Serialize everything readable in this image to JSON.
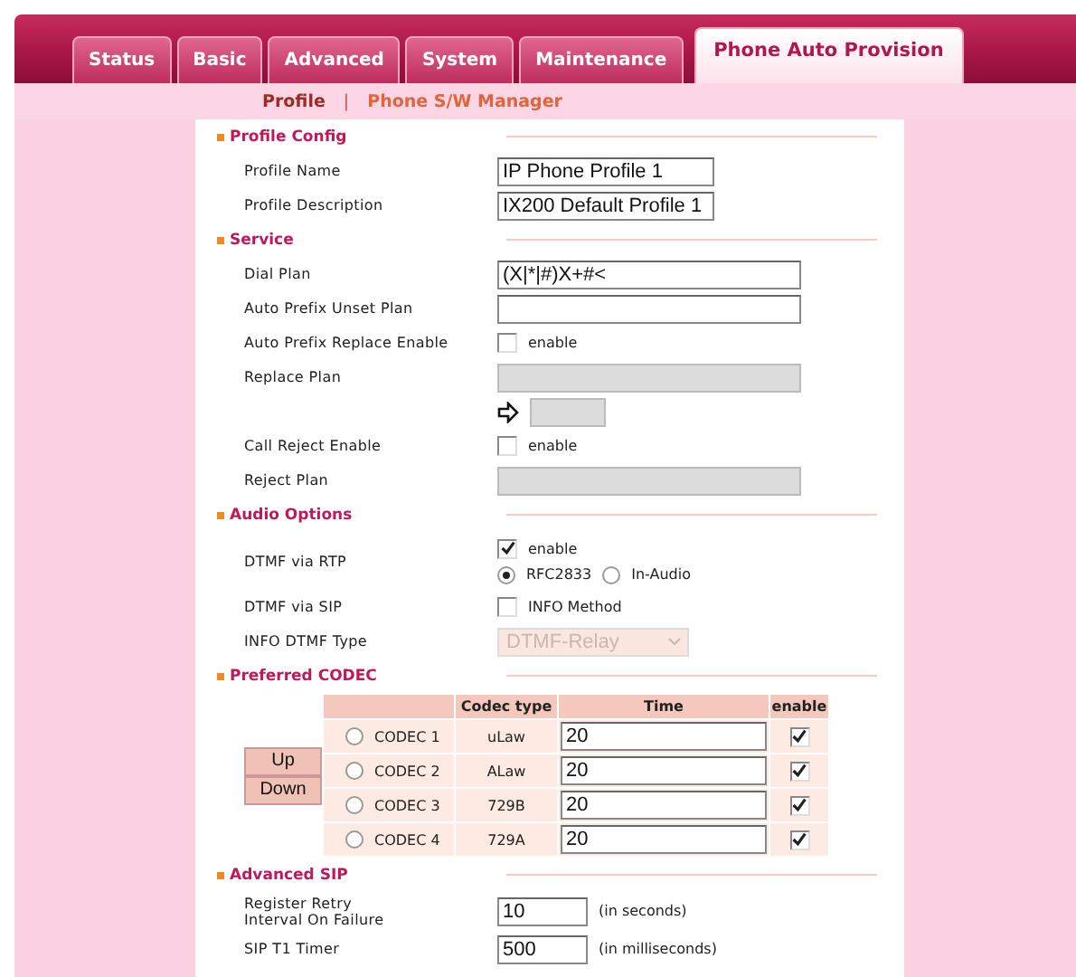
{
  "tabs": [
    {
      "label": "Status",
      "selected": false
    },
    {
      "label": "Basic",
      "selected": false
    },
    {
      "label": "Advanced",
      "selected": false
    },
    {
      "label": "System",
      "selected": false
    },
    {
      "label": "Maintenance",
      "selected": false
    },
    {
      "label": "Phone Auto Provision",
      "selected": true
    }
  ],
  "subnav": {
    "separator": "|",
    "items": [
      {
        "label": "Profile",
        "selected": true
      },
      {
        "label": "Phone S/W Manager",
        "selected": false
      }
    ]
  },
  "sections": [
    {
      "title": "Profile Config",
      "kind": "form",
      "rows": [
        {
          "kind": "short",
          "label": "Profile Name",
          "value": "IP Phone Profile 1",
          "disabled": false
        },
        {
          "kind": "short",
          "label": "Profile Description",
          "value": "IX200 Default Profile 1",
          "disabled": false
        }
      ]
    },
    {
      "title": "Service",
      "kind": "form",
      "rows": [
        {
          "kind": "text",
          "label": "Dial Plan",
          "value": "(X|*|#)X+#<",
          "disabled": false
        },
        {
          "kind": "text",
          "label": "Auto Prefix Unset Plan",
          "disabled": false
        },
        {
          "kind": "checkbox",
          "label": "Auto Prefix Replace Enable",
          "option": "enable",
          "checked": false
        },
        {
          "kind": "text",
          "label": "Replace Plan",
          "disabled": true
        },
        {
          "kind": "arrow",
          "disabled": true
        },
        {
          "kind": "checkbox",
          "label": "Call Reject Enable",
          "option": "enable",
          "checked": false
        },
        {
          "kind": "text",
          "label": "Reject Plan",
          "disabled": true
        }
      ]
    },
    {
      "title": "Audio Options",
      "kind": "form",
      "rows": [
        {
          "kind": "rtp",
          "label": "DTMF via RTP",
          "option": "enable",
          "checked": true,
          "radios": [
            {
              "label": "RFC2833",
              "selected": true
            },
            {
              "label": "In-Audio",
              "selected": false
            }
          ]
        },
        {
          "kind": "checkbox",
          "label": "DTMF via SIP",
          "option": "INFO Method",
          "checked": false
        },
        {
          "kind": "select",
          "label": "INFO DTMF Type",
          "value": "DTMF-Relay",
          "disabled": true
        }
      ]
    },
    {
      "title": "Preferred CODEC",
      "kind": "codec",
      "buttons": [
        "Up",
        "Down"
      ],
      "columns": [
        "Codec type",
        "Time",
        "enable"
      ],
      "rows": [
        {
          "name": "CODEC 1",
          "selected": false,
          "type": "uLaw",
          "time": "20",
          "enabled": true
        },
        {
          "name": "CODEC 2",
          "selected": false,
          "type": "ALaw",
          "time": "20",
          "enabled": true
        },
        {
          "name": "CODEC 3",
          "selected": false,
          "type": "729B",
          "time": "20",
          "enabled": true
        },
        {
          "name": "CODEC 4",
          "selected": false,
          "type": "729A",
          "time": "20",
          "enabled": true
        }
      ]
    },
    {
      "title": "Advanced SIP",
      "kind": "form",
      "rows": [
        {
          "kind": "unit",
          "label": "Register Retry Interval On Failure",
          "value": "10",
          "unit": "(in seconds)"
        },
        {
          "kind": "unit",
          "label": "SIP T1 Timer",
          "value": "500",
          "unit": "(in milliseconds)"
        }
      ]
    }
  ]
}
